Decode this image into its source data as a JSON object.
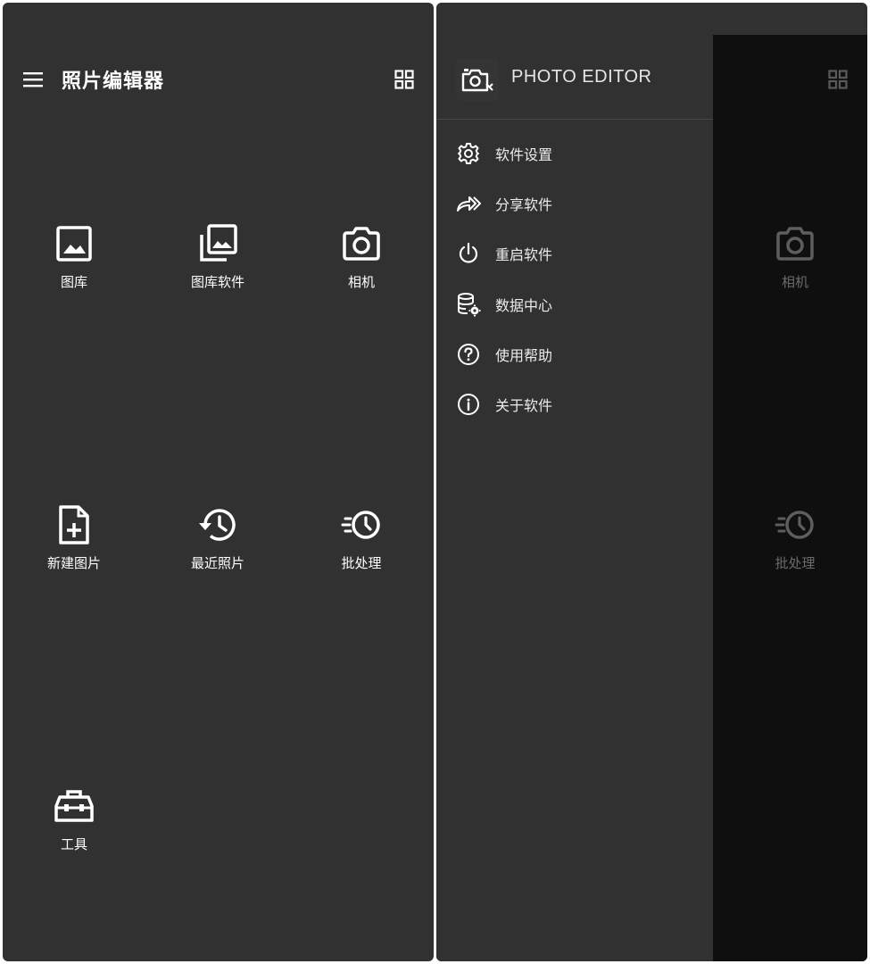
{
  "left": {
    "header": {
      "title": "照片编辑器",
      "menu_icon": "menu-icon",
      "grid_icon": "grid-view-icon"
    },
    "tiles": [
      {
        "label": "图库",
        "icon": "image-icon"
      },
      {
        "label": "图库软件",
        "icon": "photo-library-icon"
      },
      {
        "label": "相机",
        "icon": "camera-icon"
      },
      {
        "label": "新建图片",
        "icon": "new-file-icon"
      },
      {
        "label": "最近照片",
        "icon": "history-icon"
      },
      {
        "label": "批处理",
        "icon": "batch-clock-icon"
      },
      {
        "label": "工具",
        "icon": "toolbox-icon"
      }
    ]
  },
  "right": {
    "drawer": {
      "title": "PHOTO EDITOR",
      "items": [
        {
          "label": "软件设置",
          "icon": "settings-icon"
        },
        {
          "label": "分享软件",
          "icon": "share-icon"
        },
        {
          "label": "重启软件",
          "icon": "power-icon"
        },
        {
          "label": "数据中心",
          "icon": "database-settings-icon"
        },
        {
          "label": "使用帮助",
          "icon": "help-icon"
        },
        {
          "label": "关于软件",
          "icon": "info-icon"
        }
      ]
    },
    "background_tiles": [
      {
        "label": "相机"
      },
      {
        "label": "批处理"
      }
    ]
  },
  "colors": {
    "background": "#313131",
    "scrim": "#0f0f0f",
    "text": "#ffffff",
    "dimmed_text": "#6b6b6b"
  }
}
